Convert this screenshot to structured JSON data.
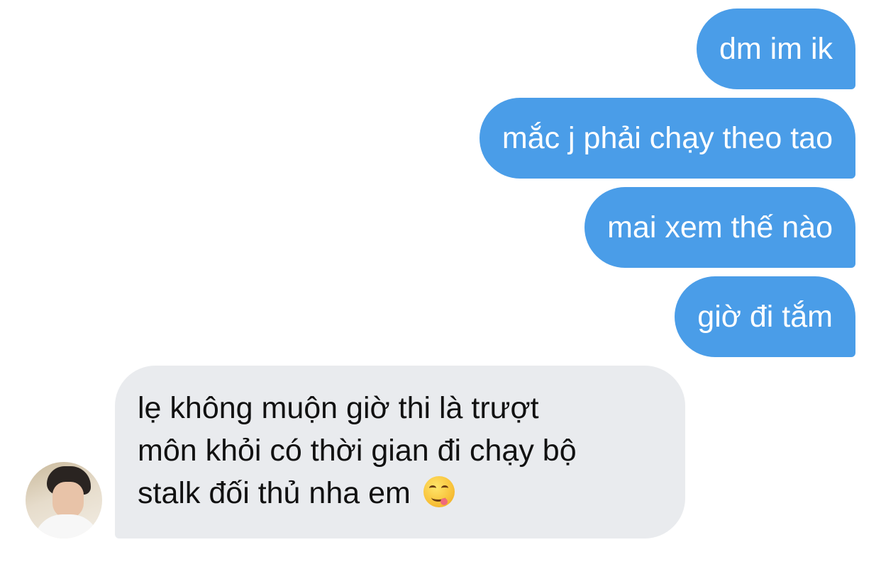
{
  "messages_outgoing": [
    {
      "text": "dm im ik"
    },
    {
      "text": "mắc j phải chạy theo tao"
    },
    {
      "text": "mai xem thế nào"
    },
    {
      "text": "giờ đi tắm"
    }
  ],
  "message_incoming": {
    "lines": [
      "lẹ không muộn giờ thi là trượt",
      "môn khỏi có thời gian đi chạy bộ",
      "stalk đối thủ nha em"
    ],
    "emoji": "yum-face-emoji"
  },
  "colors": {
    "outgoing_bubble": "#4a9de8",
    "incoming_bubble": "#e9ebee",
    "background": "#ffffff"
  }
}
